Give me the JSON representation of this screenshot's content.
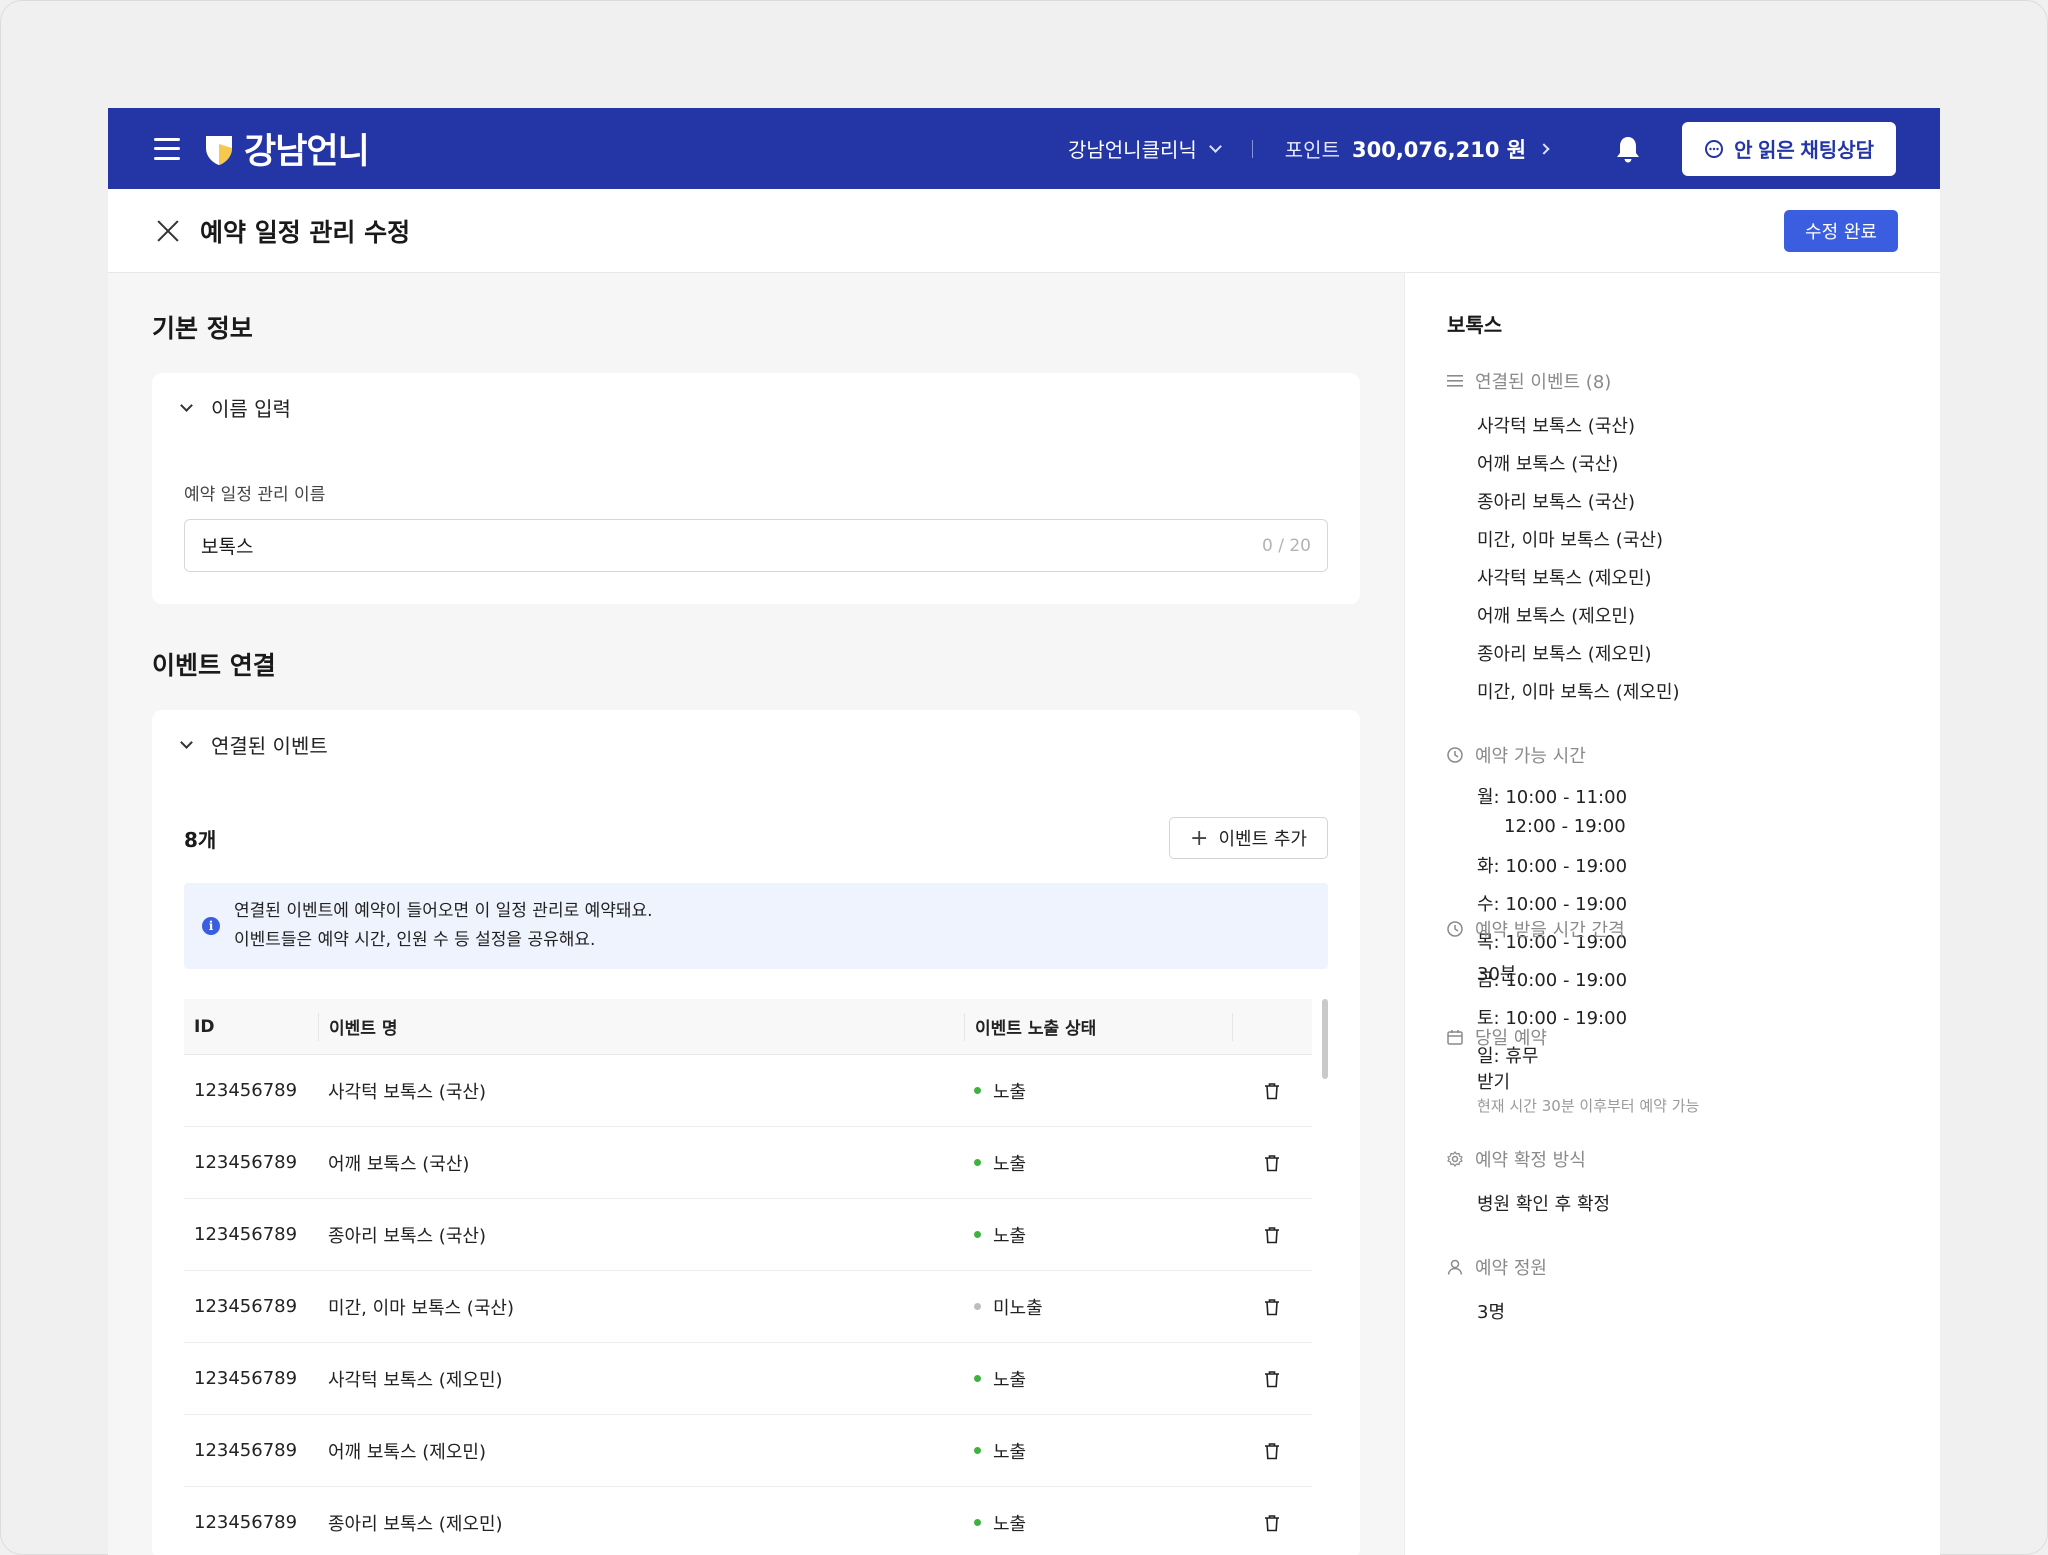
{
  "header": {
    "logo_text": "강남언니",
    "clinic_name": "강남언니클리닉",
    "points_label": "포인트",
    "points_value": "300,076,210 원",
    "chat_button": "안 읽은 채팅상담"
  },
  "subheader": {
    "title": "예약 일정 관리 수정",
    "done_button": "수정 완료"
  },
  "basic_info": {
    "section_title": "기본 정보",
    "card_title": "이름 입력",
    "field_label": "예약 일정 관리 이름",
    "field_value": "보톡스",
    "field_counter": "0 / 20"
  },
  "events": {
    "section_title": "이벤트 연결",
    "card_title": "연결된 이벤트",
    "count": "8개",
    "add_button": "이벤트 추가",
    "notice_line1": "연결된 이벤트에 예약이 들어오면 이 일정 관리로 예약돼요.",
    "notice_line2": "이벤트들은 예약 시간, 인원 수 등 설정을 공유해요.",
    "columns": {
      "id": "ID",
      "name": "이벤트 명",
      "status": "이벤트 노출 상태"
    },
    "rows": [
      {
        "id": "123456789",
        "name": "사각턱 보톡스 (국산)",
        "status": "노출",
        "exposed": true
      },
      {
        "id": "123456789",
        "name": "어깨 보톡스 (국산)",
        "status": "노출",
        "exposed": true
      },
      {
        "id": "123456789",
        "name": "종아리 보톡스 (국산)",
        "status": "노출",
        "exposed": true
      },
      {
        "id": "123456789",
        "name": "미간, 이마 보톡스 (국산)",
        "status": "미노출",
        "exposed": false
      },
      {
        "id": "123456789",
        "name": "사각턱 보톡스 (제오민)",
        "status": "노출",
        "exposed": true
      },
      {
        "id": "123456789",
        "name": "어깨 보톡스 (제오민)",
        "status": "노출",
        "exposed": true
      },
      {
        "id": "123456789",
        "name": "종아리 보톡스 (제오민)",
        "status": "노출",
        "exposed": true
      }
    ]
  },
  "side": {
    "title": "보톡스",
    "linked_label": "연결된 이벤트 (8)",
    "linked_events": [
      "사각턱 보톡스 (국산)",
      "어깨 보톡스 (국산)",
      "종아리 보톡스 (국산)",
      "미간, 이마 보톡스 (국산)",
      "사각턱 보톡스 (제오민)",
      "어깨 보톡스 (제오민)",
      "종아리 보톡스 (제오민)",
      "미간, 이마 보톡스 (제오민)"
    ],
    "hours_label": "예약 가능 시간",
    "hours_mon_1": "월: 10:00 - 11:00",
    "hours_mon_2": "12:00 - 19:00",
    "hours_rest": [
      "화: 10:00 - 19:00",
      "수: 10:00 - 19:00",
      "목: 10:00 - 19:00",
      "금: 10:00 - 19:00",
      "토: 10:00 - 19:00",
      "일: 휴무"
    ],
    "interval_label": "예약 받을 시간 간격",
    "interval_value": "30분",
    "sameday_label": "당일 예약",
    "sameday_value": "받기",
    "sameday_note": "현재 시간 30분 이후부터 예약 가능",
    "confirm_label": "예약 확정 방식",
    "confirm_value": "병원 확인 후 확정",
    "capacity_label": "예약 정원",
    "capacity_value": "3명"
  },
  "colors": {
    "brand": "#2436a6",
    "primary_button": "#3b5ee0",
    "exposed_dot": "#3cb43c",
    "hidden_dot": "#bdbdbd"
  }
}
